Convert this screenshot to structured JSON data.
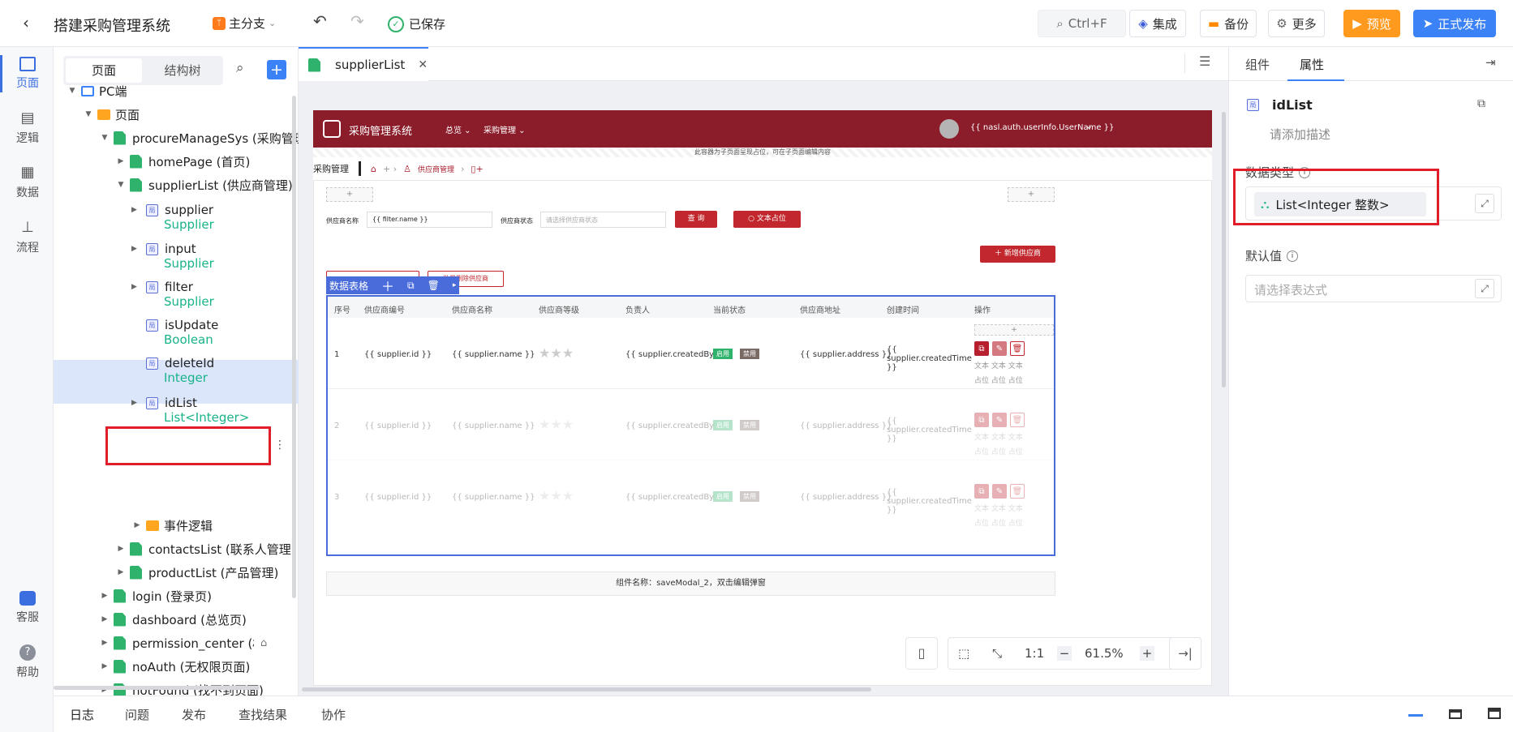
{
  "app": {
    "title": "搭建采购管理系统",
    "branch": "主分支",
    "saved": "已保存",
    "search_shortcut": "Ctrl+F",
    "buttons": {
      "integrate": "集成",
      "backup": "备份",
      "more": "更多",
      "preview": "预览",
      "publish": "正式发布"
    },
    "colors": {
      "accent": "#3b82f6",
      "preview": "#ff9a1f",
      "brand": "#8b1c2a",
      "highlight": "#e11d2a"
    }
  },
  "rail": [
    {
      "label": "页面",
      "icon": "page-icon"
    },
    {
      "label": "逻辑",
      "icon": "logic-icon"
    },
    {
      "label": "数据",
      "icon": "data-icon"
    },
    {
      "label": "流程",
      "icon": "flow-icon"
    },
    {
      "label": "客服",
      "icon": "chat-icon"
    },
    {
      "label": "帮助",
      "icon": "help-icon"
    }
  ],
  "tree": {
    "tabs": [
      "页面",
      "结构树"
    ],
    "nodes": {
      "pc": "PC端",
      "pages": "页面",
      "procure": "procureManageSys (采购管理",
      "home": "homePage (首页)",
      "supplierList": "supplierList (供应商管理)",
      "v_supplier": "supplier",
      "v_supplier_t": "Supplier",
      "v_input": "input",
      "v_input_t": "Supplier",
      "v_filter": "filter",
      "v_filter_t": "Supplier",
      "v_isUpdate": "isUpdate",
      "v_isUpdate_t": "Boolean",
      "v_deleteId": "deleteId",
      "v_deleteId_t": "Integer",
      "v_idList": "idList",
      "v_idList_t": "List<Integer>",
      "events": "事件逻辑",
      "contacts": "contactsList (联系人管理)",
      "product": "productList (产品管理)",
      "login": "login (登录页)",
      "dashboard": "dashboard (总览页)",
      "permission": "permission_center (权限",
      "noAuth": "noAuth (无权限页面)",
      "notFound": "notFound (找不到页面)"
    }
  },
  "editor": {
    "tab": "supplierList",
    "app_name": "采购管理系统",
    "nav": [
      "总览",
      "采购管理"
    ],
    "user": "{{ nasl.auth.userInfo.UserName }}",
    "sub_hint": "此容器为子页面呈现占位，可在子页面编辑内容",
    "crumb_title": "采购管理",
    "crumb_item": "供应商管理",
    "plus": "+",
    "filter_label1": "供应商名称",
    "filter_value1": "{{ filter.name }}",
    "filter_label2": "供应商状态",
    "filter_ph2": "请选择供应商状态",
    "query_btn": "查 询",
    "text_btn": "文本占位",
    "add_btn": "新增供应商",
    "toolbar_label": "数据表格",
    "batch_btn": "批量删除供应商",
    "columns": [
      "序号",
      "供应商编号",
      "供应商名称",
      "供应商等级",
      "负责人",
      "当前状态",
      "供应商地址",
      "创建时间",
      "操作"
    ],
    "rows": [
      {
        "idx": "1",
        "id": "{{ supplier.id }}",
        "name": "{{ supplier.name }}",
        "by": "{{ supplier.createdBy }}",
        "addr": "{{ supplier.address }}",
        "time": "{{ supplier.createdTime }}"
      },
      {
        "idx": "2",
        "id": "{{ supplier.id }}",
        "name": "{{ supplier.name }}",
        "by": "{{ supplier.createdBy }}",
        "addr": "{{ supplier.address }}",
        "time": "{{ supplier.createdTime }}"
      },
      {
        "idx": "3",
        "id": "{{ supplier.id }}",
        "name": "{{ supplier.name }}",
        "by": "{{ supplier.createdBy }}",
        "addr": "{{ supplier.address }}",
        "time": "{{ supplier.createdTime }}"
      }
    ],
    "status_on": "启用",
    "status_off": "禁用",
    "op_text": "文本 文本 文本",
    "op_text2": "占位 占位 占位",
    "modal_hint": "组件名称：saveModal_2，双击编辑弹窗",
    "zoom": "61.5%",
    "ratio": "1:1"
  },
  "props": {
    "tabs": [
      "组件",
      "属性"
    ],
    "name": "idList",
    "desc_ph": "请添加描述",
    "type_label": "数据类型",
    "type_value": "List<Integer 整数>",
    "default_label": "默认值",
    "default_ph": "请选择表达式"
  },
  "bottom": [
    "日志",
    "问题",
    "发布",
    "查找结果",
    "协作"
  ]
}
